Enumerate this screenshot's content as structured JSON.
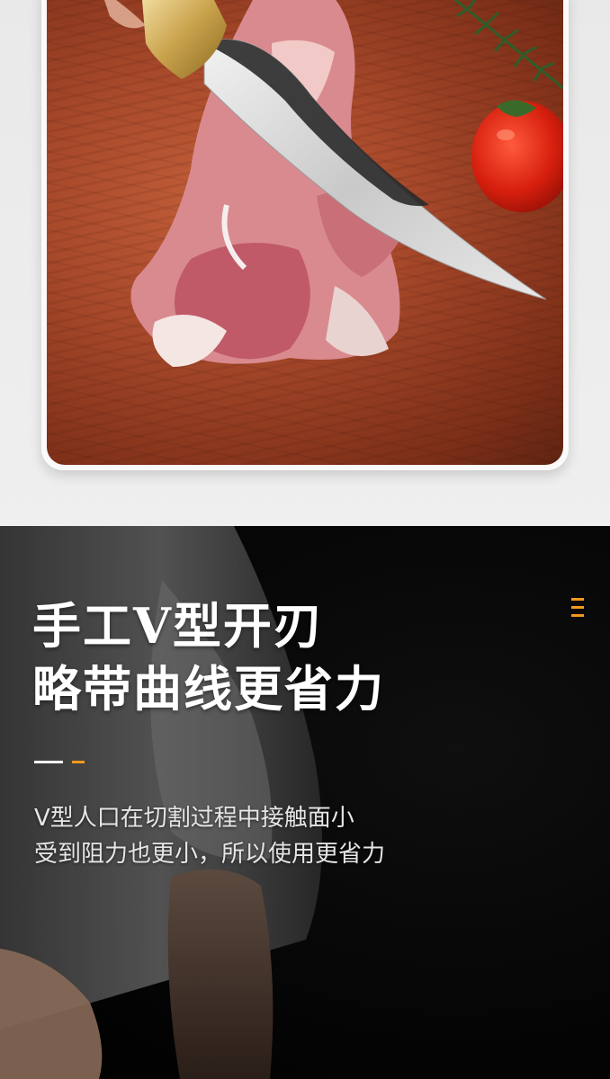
{
  "photo": {
    "subject_icons": [
      "knife-icon",
      "meat-icon",
      "tomato-icon",
      "rosemary-icon"
    ],
    "board_color": "#a6482a"
  },
  "info": {
    "headline_line1": "手工V型开刃",
    "headline_line2": "略带曲线更省力",
    "description_line1": "V型人口在切割过程中接触面小",
    "description_line2": "受到阻力也更小，所以使用更省力",
    "menu_icon": "menu-icon",
    "accent_color": "#f29a1e"
  }
}
